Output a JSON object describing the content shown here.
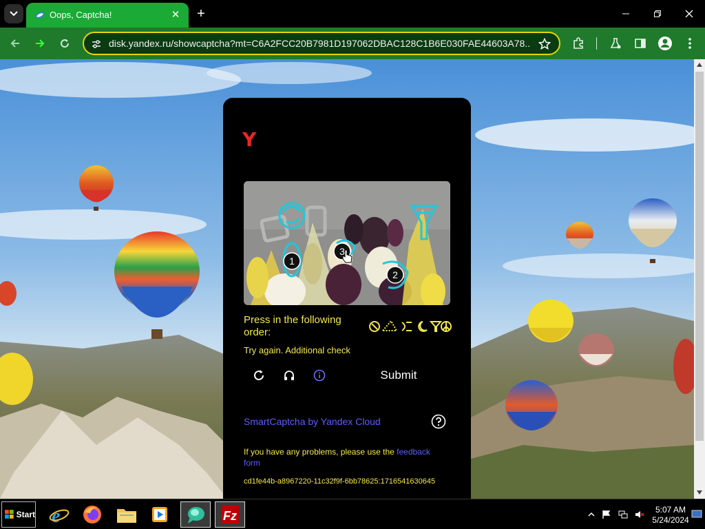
{
  "browser": {
    "tab_title": "Oops, Captcha!",
    "tab_close": "✕",
    "new_tab": "+",
    "url": "disk.yandex.ru/showcaptcha?mt=C6A2FCC20B7981D197062DBAC128C1B6E030FAE44603A78..."
  },
  "captcha": {
    "logo": "Y",
    "instruction": "Press in the following order:",
    "status": "Try again. Additional check",
    "submit_label": "Submit",
    "brand_link": "SmartCaptcha by Yandex Cloud",
    "problems_text": "If you have any problems, please use the ",
    "feedback_link": "feedback form",
    "token": "cd1fe44b-a8967220-11c32f9f-6bb78625:1716541630645",
    "markers": [
      "1",
      "2",
      "3"
    ],
    "order_icons": [
      "paperclip-icon",
      "triangle-icon",
      "bracket-icon",
      "moon-icon",
      "funnel-icon",
      "peace-icon"
    ]
  },
  "taskbar": {
    "start_label": "Start",
    "apps": [
      "internet-explorer",
      "firefox",
      "file-explorer",
      "media-player",
      "chat-app",
      "filezilla"
    ],
    "time": "5:07 AM",
    "date": "5/24/2024"
  },
  "colors": {
    "tab_green": "#1aaa35",
    "toolbar_green": "#1f7a2c",
    "omnibox_border": "#e3d800",
    "captcha_yellow": "#f5e84a",
    "link_blue": "#5d5dff",
    "yandex_red": "#e5282a",
    "marker_cyan": "#1ec8dc"
  }
}
